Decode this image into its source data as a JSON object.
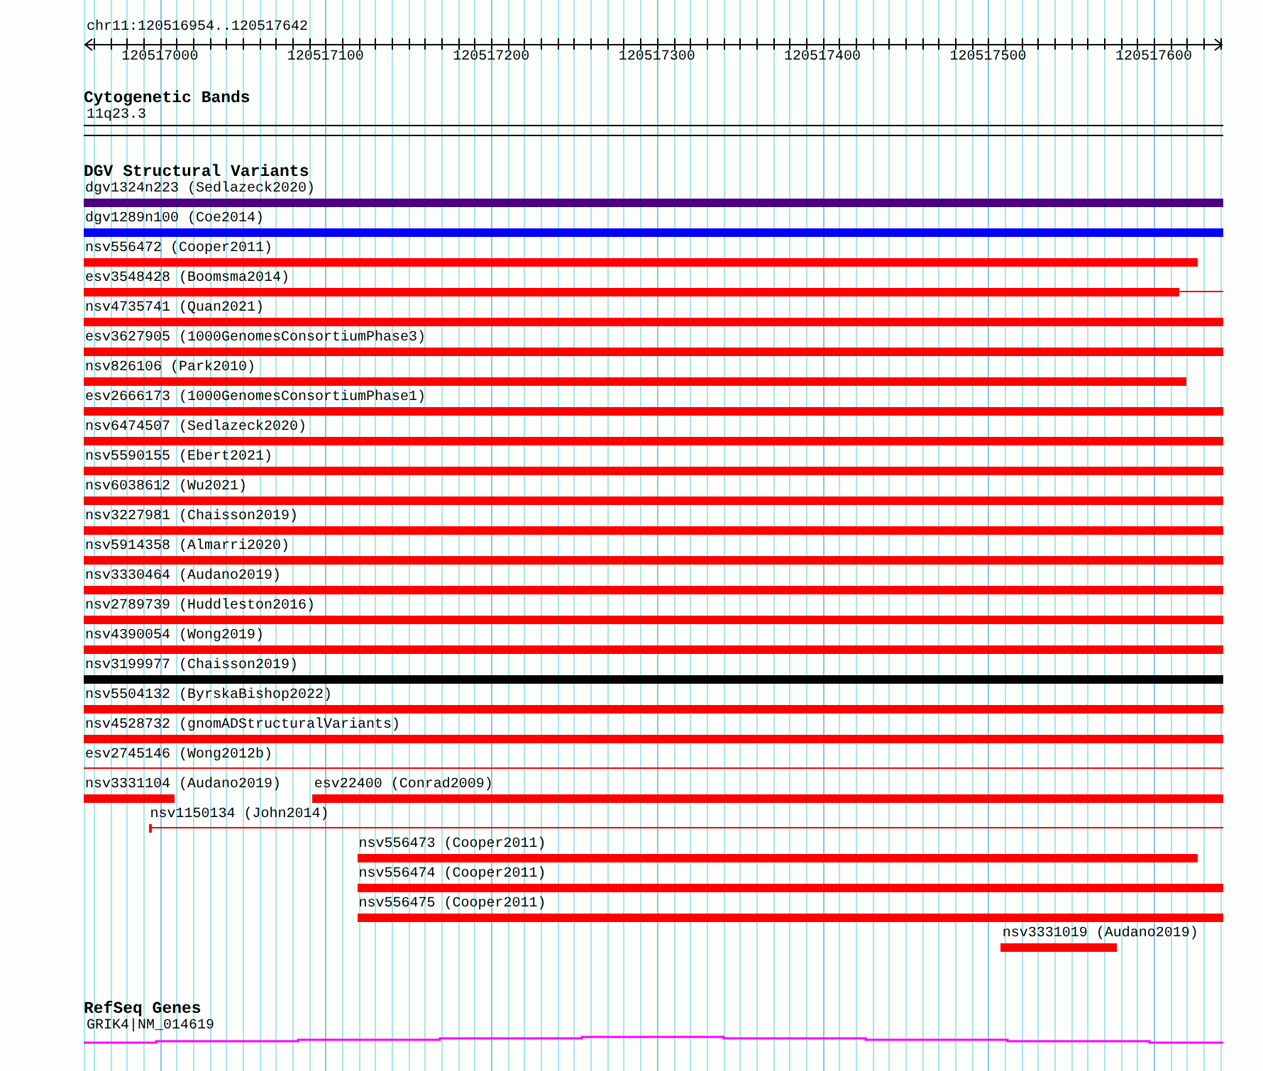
{
  "location": "chr11:120516954..120517642",
  "ruler_ticks": [
    "120517000",
    "120517100",
    "120517200",
    "120517300",
    "120517400",
    "120517500",
    "120517600"
  ],
  "tracks": [
    {
      "kind": "bands",
      "title": "Cytogenetic Bands",
      "band": {
        "name": "11q23.3"
      }
    },
    {
      "kind": "features",
      "title": "DGV Structural Variants",
      "rows": [
        [
          {
            "label": "dgv1324n223 (Sedlazeck2020)",
            "color": "#4b0082",
            "segments": [
              {
                "kind": "thick"
              }
            ]
          }
        ],
        [
          {
            "label": "dgv1289n100 (Coe2014)",
            "color": "#0000ff",
            "segments": [
              {
                "kind": "thick"
              }
            ]
          }
        ],
        [
          {
            "label": "nsv556472 (Cooper2011)",
            "color": "#ff0000",
            "segments": [
              {
                "kind": "thick"
              }
            ]
          }
        ],
        [
          {
            "label": "esv3548428 (Boomsma2014)",
            "color": "#ff0000",
            "segments": [
              {
                "kind": "thick"
              },
              {
                "kind": "thin"
              }
            ]
          }
        ],
        [
          {
            "label": "nsv4735741 (Quan2021)",
            "color": "#ff0000",
            "segments": [
              {
                "kind": "thick"
              }
            ]
          }
        ],
        [
          {
            "label": "esv3627905 (1000GenomesConsortiumPhase3)",
            "color": "#ff0000",
            "segments": [
              {
                "kind": "thick"
              }
            ]
          }
        ],
        [
          {
            "label": "nsv826106 (Park2010)",
            "color": "#ff0000",
            "segments": [
              {
                "kind": "thick"
              }
            ]
          }
        ],
        [
          {
            "label": "esv2666173 (1000GenomesConsortiumPhase1)",
            "color": "#ff0000",
            "segments": [
              {
                "kind": "thick"
              }
            ]
          }
        ],
        [
          {
            "label": "nsv6474507 (Sedlazeck2020)",
            "color": "#ff0000",
            "segments": [
              {
                "kind": "thick"
              }
            ]
          }
        ],
        [
          {
            "label": "nsv5590155 (Ebert2021)",
            "color": "#ff0000",
            "segments": [
              {
                "kind": "thick"
              }
            ]
          }
        ],
        [
          {
            "label": "nsv6038612 (Wu2021)",
            "color": "#ff0000",
            "segments": [
              {
                "kind": "thick"
              }
            ]
          }
        ],
        [
          {
            "label": "nsv3227981 (Chaisson2019)",
            "color": "#ff0000",
            "segments": [
              {
                "kind": "thick"
              }
            ]
          }
        ],
        [
          {
            "label": "nsv5914358 (Almarri2020)",
            "color": "#ff0000",
            "segments": [
              {
                "kind": "thick"
              }
            ]
          }
        ],
        [
          {
            "label": "nsv3330464 (Audano2019)",
            "color": "#ff0000",
            "segments": [
              {
                "kind": "thick"
              }
            ]
          }
        ],
        [
          {
            "label": "nsv2789739 (Huddleston2016)",
            "color": "#ff0000",
            "segments": [
              {
                "kind": "thick"
              }
            ]
          }
        ],
        [
          {
            "label": "nsv4390054 (Wong2019)",
            "color": "#ff0000",
            "segments": [
              {
                "kind": "thick"
              }
            ]
          }
        ],
        [
          {
            "label": "nsv3199977 (Chaisson2019)",
            "color": "#000000",
            "segments": [
              {
                "kind": "thick"
              }
            ]
          }
        ],
        [
          {
            "label": "nsv5504132 (ByrskaBishop2022)",
            "color": "#ff0000",
            "segments": [
              {
                "kind": "thick"
              }
            ]
          }
        ],
        [
          {
            "label": "nsv4528732 (gnomADStructuralVariants)",
            "color": "#ff0000",
            "segments": [
              {
                "kind": "thick"
              }
            ]
          }
        ],
        [
          {
            "label": "esv2745146 (Wong2012b)",
            "color": "#ff0000",
            "segments": [
              {
                "kind": "thin"
              }
            ]
          }
        ],
        [
          {
            "label": "nsv3331104 (Audano2019)",
            "color": "#ff0000",
            "segments": [
              {
                "kind": "thick"
              }
            ]
          },
          {
            "label": "esv22400 (Conrad2009)",
            "color": "#ff0000",
            "segments": [
              {
                "kind": "thick"
              }
            ]
          }
        ],
        [
          {
            "label": "nsv1150134 (John2014)",
            "color": "#ff0000",
            "segments": [
              {
                "kind": "cap"
              },
              {
                "kind": "thin"
              }
            ]
          }
        ],
        [
          {
            "label": "nsv556473 (Cooper2011)",
            "color": "#ff0000",
            "segments": [
              {
                "kind": "thick"
              }
            ]
          }
        ],
        [
          {
            "label": "nsv556474 (Cooper2011)",
            "color": "#ff0000",
            "segments": [
              {
                "kind": "thick"
              }
            ]
          }
        ],
        [
          {
            "label": "nsv556475 (Cooper2011)",
            "color": "#ff0000",
            "segments": [
              {
                "kind": "thick"
              }
            ]
          }
        ],
        [
          {
            "label": "nsv3331019 (Audano2019)",
            "color": "#ff0000",
            "segments": [
              {
                "kind": "thick"
              }
            ]
          }
        ]
      ]
    },
    {
      "kind": "gene",
      "title": "RefSeq Genes",
      "gene": {
        "name": "GRIK4|NM_014619"
      }
    }
  ]
}
